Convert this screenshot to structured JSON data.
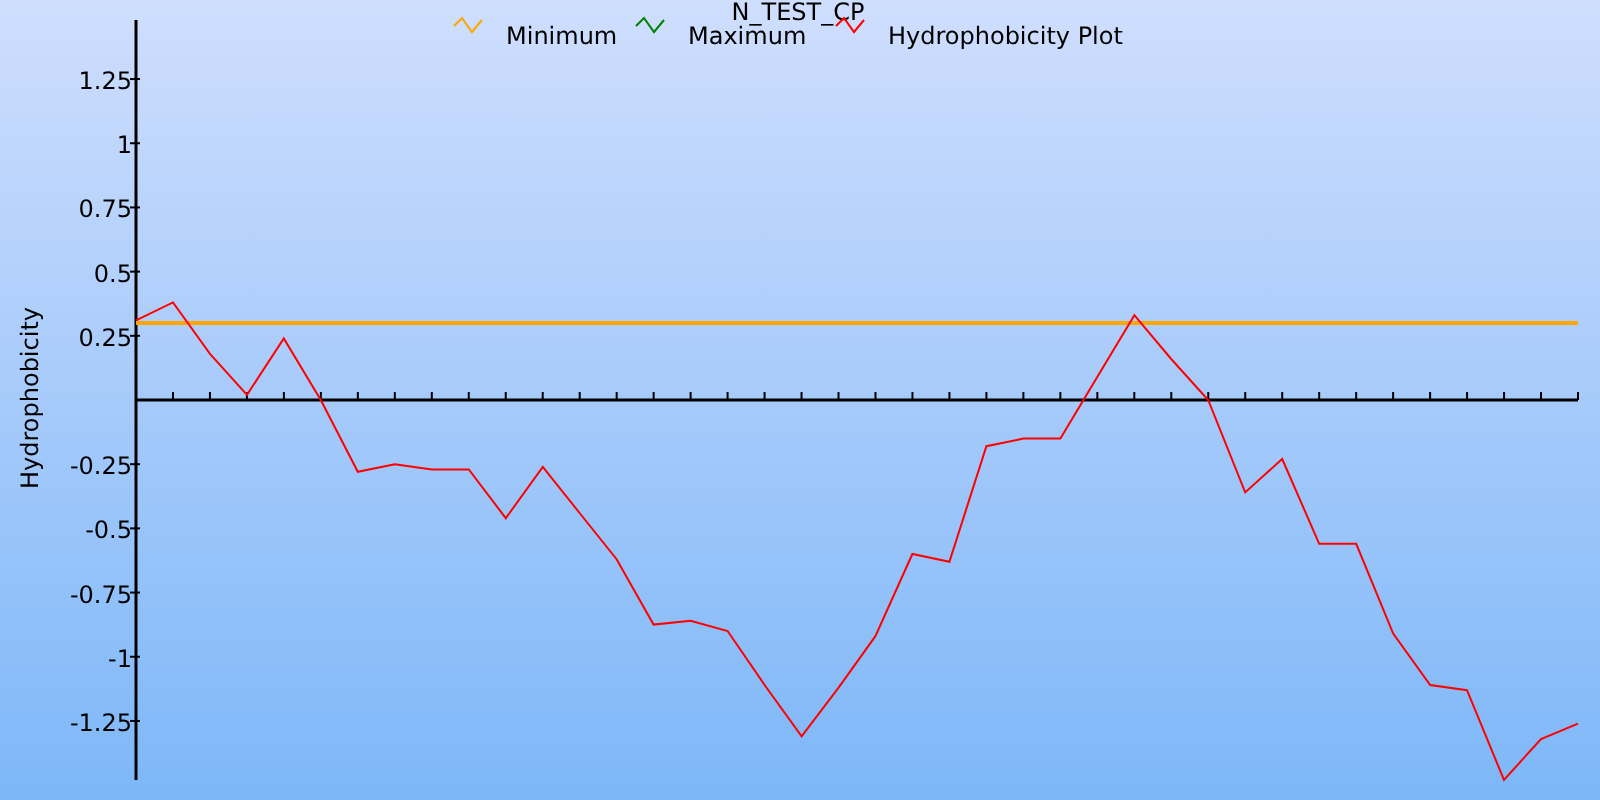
{
  "chart_data": {
    "type": "line",
    "title": "N_TEST_CP",
    "ylabel": "Hydrophobicity",
    "categories": [
      null,
      null,
      null,
      null,
      null,
      null,
      null,
      null,
      null,
      null,
      null,
      null,
      null,
      null,
      null,
      null,
      null,
      null,
      null,
      null,
      null,
      null,
      null,
      null,
      null,
      null,
      null,
      null,
      null,
      null,
      null,
      null,
      null,
      null,
      null,
      null,
      null,
      null,
      null,
      null
    ],
    "ylim": [
      -1.48,
      1.48
    ],
    "legend": true,
    "yticks": [
      1.25,
      1,
      0.75,
      0.5,
      0.25,
      -0.25,
      -0.5,
      -0.75,
      -1,
      -1.25
    ],
    "series": [
      {
        "name": "Minimum",
        "color": "#ffa500",
        "values": [
          0.3,
          0.3,
          0.3,
          0.3,
          0.3,
          0.3,
          0.3,
          0.3,
          0.3,
          0.3,
          0.3,
          0.3,
          0.3,
          0.3,
          0.3,
          0.3,
          0.3,
          0.3,
          0.3,
          0.3,
          0.3,
          0.3,
          0.3,
          0.3,
          0.3,
          0.3,
          0.3,
          0.3,
          0.3,
          0.3,
          0.3,
          0.3,
          0.3,
          0.3,
          0.3,
          0.3,
          0.3,
          0.3,
          0.3,
          0.3
        ]
      },
      {
        "name": "Maximum",
        "color": "#008000",
        "values": [
          null,
          null,
          null,
          null,
          null,
          null,
          null,
          null,
          null,
          null,
          null,
          null,
          null,
          null,
          null,
          null,
          null,
          null,
          null,
          null,
          null,
          null,
          null,
          null,
          null,
          null,
          null,
          null,
          null,
          null,
          null,
          null,
          null,
          null,
          null,
          null,
          null,
          null,
          null,
          null
        ]
      },
      {
        "name": "Hydrophobicity Plot",
        "color": "#ff0000",
        "values": [
          0.31,
          0.38,
          0.18,
          0.02,
          0.24,
          0.0,
          -0.28,
          -0.25,
          -0.27,
          -0.27,
          -0.46,
          -0.26,
          -0.44,
          -0.62,
          -0.875,
          -0.86,
          -0.9,
          -1.11,
          -1.31,
          -1.12,
          -0.92,
          -0.6,
          -0.63,
          -0.18,
          -0.15,
          -0.15,
          0.09,
          0.33,
          0.16,
          0.0,
          -0.36,
          -0.23,
          -0.56,
          -0.56,
          -0.91,
          -1.11,
          -1.13,
          -1.48,
          -1.32,
          -1.26
        ]
      }
    ]
  }
}
